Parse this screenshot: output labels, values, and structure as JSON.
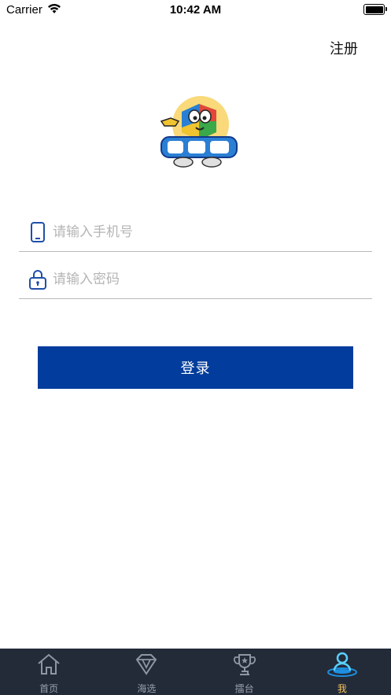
{
  "status_bar": {
    "carrier": "Carrier",
    "time": "10:42 AM"
  },
  "header": {
    "register_label": "注册"
  },
  "form": {
    "phone_placeholder": "请输入手机号",
    "password_placeholder": "请输入密码",
    "login_label": "登录"
  },
  "tabbar": {
    "tabs": [
      {
        "label": "首页",
        "icon": "home-icon",
        "active": false
      },
      {
        "label": "海选",
        "icon": "diamond-icon",
        "active": false
      },
      {
        "label": "擂台",
        "icon": "trophy-icon",
        "active": false
      },
      {
        "label": "我",
        "icon": "user-icon",
        "active": true
      }
    ]
  },
  "colors": {
    "primary": "#023c9c",
    "tabbar_bg": "#232b39",
    "tab_active": "#f5c25a",
    "tab_inactive": "#9aa0aa"
  }
}
